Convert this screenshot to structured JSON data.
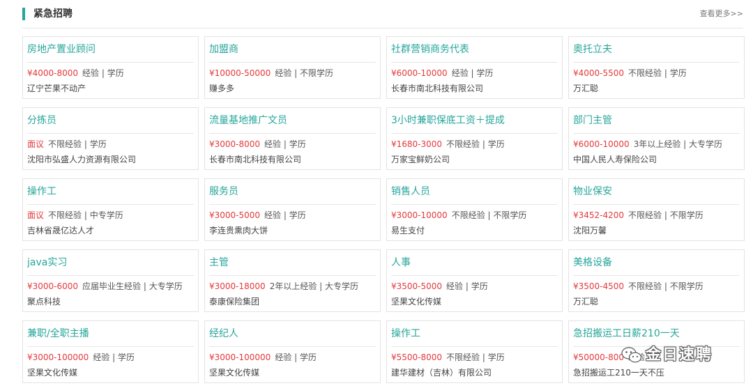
{
  "header": {
    "title": "紧急招聘",
    "more": "查看更多>>"
  },
  "jobs": [
    {
      "title": "房地产置业顾问",
      "salary": "¥4000-8000",
      "req": "经验 | 学历",
      "company": "辽宁芒果不动产"
    },
    {
      "title": "加盟商",
      "salary": "¥10000-50000",
      "req": "经验 | 不限学历",
      "company": "赚多多"
    },
    {
      "title": "社群营销商务代表",
      "salary": "¥6000-10000",
      "req": "经验 | 学历",
      "company": "长春市南北科技有限公司"
    },
    {
      "title": "奥托立夫",
      "salary": "¥4000-5500",
      "req": "不限经验 | 学历",
      "company": "万汇聪"
    },
    {
      "title": "分拣员",
      "salary": "面议",
      "req": "不限经验 | 学历",
      "company": "沈阳市弘盛人力资源有限公司"
    },
    {
      "title": "流量基地推广文员",
      "salary": "¥3000-8000",
      "req": "经验 | 学历",
      "company": "长春市南北科技有限公司"
    },
    {
      "title": "3小时兼职保底工资＋提成",
      "salary": "¥1680-3000",
      "req": "不限经验 | 学历",
      "company": "万家宝鲜奶公司"
    },
    {
      "title": "部门主管",
      "salary": "¥6000-10000",
      "req": "3年以上经验 | 大专学历",
      "company": "中国人民人寿保险公司"
    },
    {
      "title": "操作工",
      "salary": "面议",
      "req": "不限经验 | 中专学历",
      "company": "吉林省晟亿达人才"
    },
    {
      "title": "服务员",
      "salary": "¥3000-5000",
      "req": "经验 | 学历",
      "company": "李连贵熏肉大饼"
    },
    {
      "title": "销售人员",
      "salary": "¥3000-10000",
      "req": "不限经验 | 不限学历",
      "company": "易生支付"
    },
    {
      "title": "物业保安",
      "salary": "¥3452-4200",
      "req": "不限经验 | 不限学历",
      "company": "沈阳万馨"
    },
    {
      "title": "java实习",
      "salary": "¥3000-6000",
      "req": "应届毕业生经验 | 大专学历",
      "company": "聚点科技"
    },
    {
      "title": "主管",
      "salary": "¥3000-18000",
      "req": "2年以上经验 | 大专学历",
      "company": "泰康保险集团"
    },
    {
      "title": "人事",
      "salary": "¥3500-5000",
      "req": "经验 | 学历",
      "company": "坚果文化传媒"
    },
    {
      "title": "美格设备",
      "salary": "¥3500-4500",
      "req": "不限经验 | 不限学历",
      "company": "万汇聪"
    },
    {
      "title": "兼职/全职主播",
      "salary": "¥3000-100000",
      "req": "经验 | 学历",
      "company": "坚果文化传媒"
    },
    {
      "title": "经纪人",
      "salary": "¥3000-100000",
      "req": "经验 | 学历",
      "company": "坚果文化传媒"
    },
    {
      "title": "操作工",
      "salary": "¥5500-8000",
      "req": "不限经验 | 学历",
      "company": "建华建材（吉林）有限公司"
    },
    {
      "title": "急招搬运工日薪210一天",
      "salary": "¥50000-800",
      "req": "经验",
      "company": "急招搬运工210一天不压"
    }
  ],
  "watermark": {
    "text": "金日速聘",
    "icon": "wechat-icon"
  },
  "colors": {
    "accent": "#26a69a",
    "salary": "#e4393c"
  }
}
